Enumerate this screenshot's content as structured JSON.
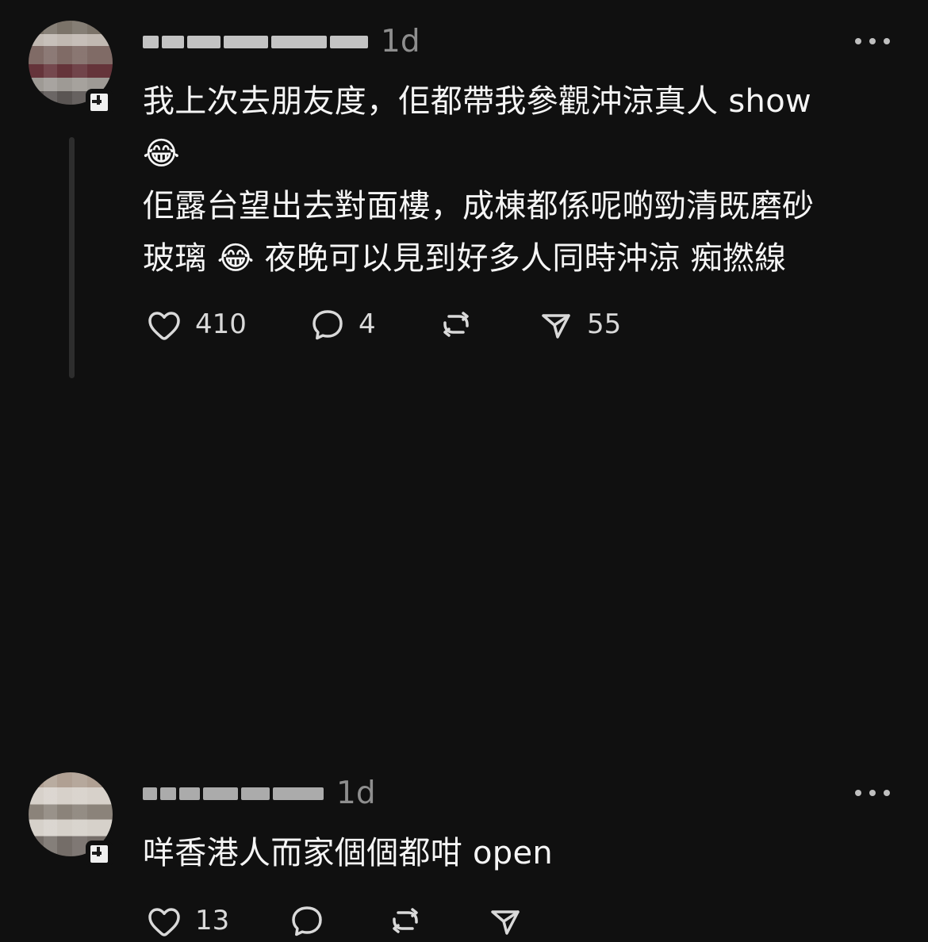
{
  "posts": [
    {
      "username": "u*** ****",
      "time": "1d",
      "text": [
        "我上次去朋友度，佢都帶我參觀沖涼真人 show",
        "😂",
        "佢露台望出去對面樓，成棟都係呢啲勁清既磨砂",
        "玻璃 😂 夜晚可以見到好多人同時沖涼 痴撚線"
      ],
      "actions": {
        "likes": "410",
        "replies": "4",
        "reposts": "",
        "shares": "55"
      }
    },
    {
      "username": "n***** ****",
      "time": "1d",
      "text": [
        "咩香港人而家個個都咁 open"
      ],
      "actions": {
        "likes": "13",
        "replies": "",
        "reposts": "",
        "shares": ""
      }
    }
  ]
}
